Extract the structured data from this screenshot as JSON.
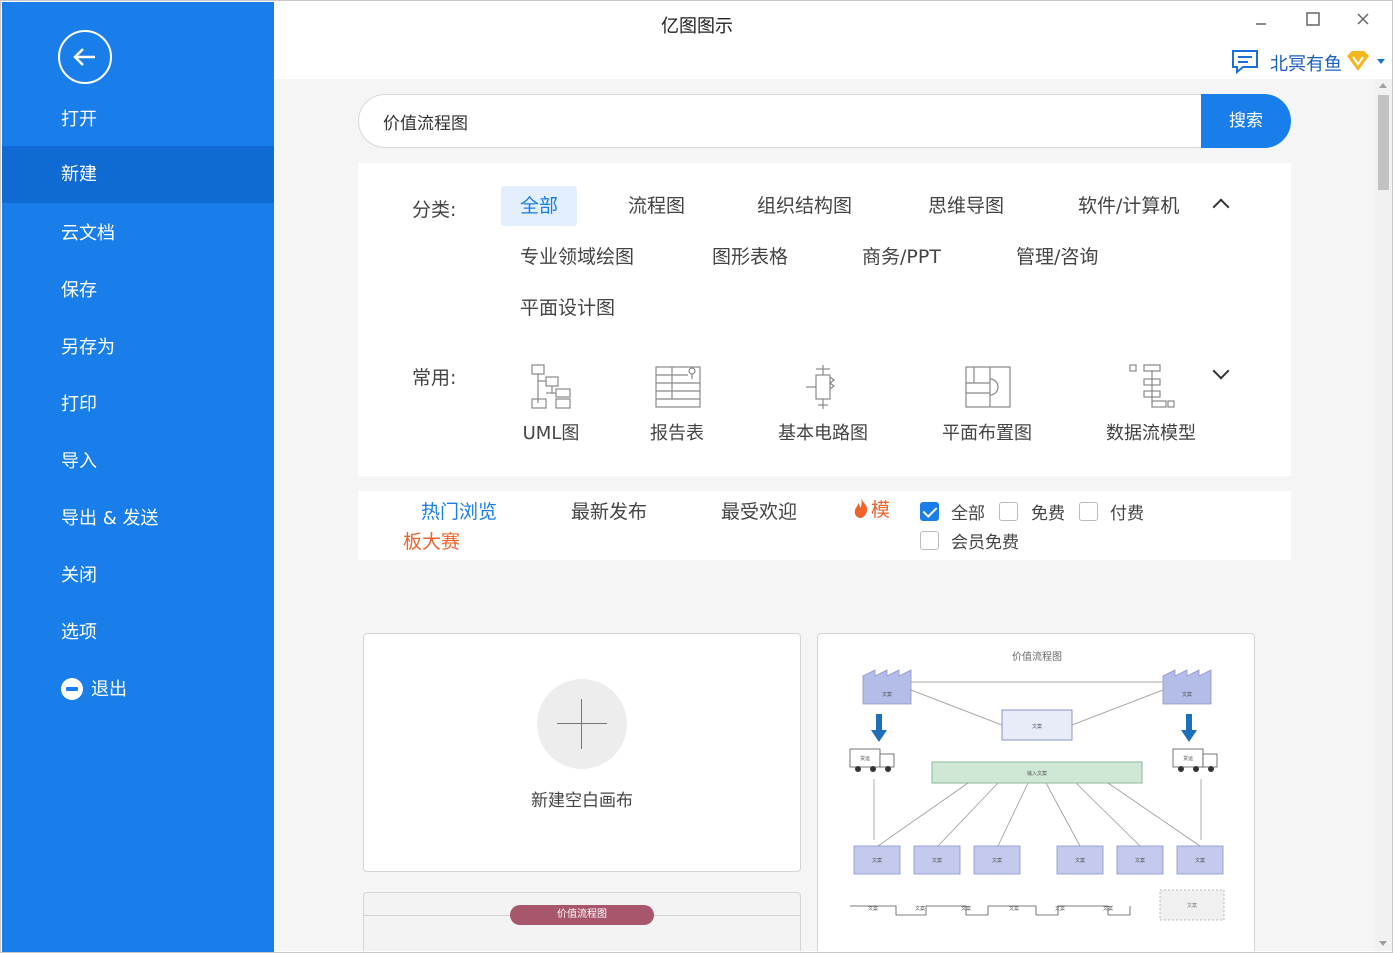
{
  "window": {
    "title": "亿图图示",
    "minimize_label": "–",
    "maximize_label": "□",
    "close_label": "✕"
  },
  "user": {
    "name": "北冥有鱼"
  },
  "sidebar": {
    "items": [
      {
        "label": "打开"
      },
      {
        "label": "新建"
      },
      {
        "label": "云文档"
      },
      {
        "label": "保存"
      },
      {
        "label": "另存为"
      },
      {
        "label": "打印"
      },
      {
        "label": "导入"
      },
      {
        "label": "导出 & 发送"
      },
      {
        "label": "关闭"
      },
      {
        "label": "选项"
      },
      {
        "label": "退出"
      }
    ],
    "active_index": 1
  },
  "search": {
    "value": "价值流程图",
    "button_label": "搜索"
  },
  "categories": {
    "label": "分类:",
    "items": [
      "全部",
      "流程图",
      "组织结构图",
      "思维导图",
      "软件/计算机",
      "专业领域绘图",
      "图形表格",
      "商务/PPT",
      "管理/咨询",
      "平面设计图"
    ],
    "active": "全部"
  },
  "common": {
    "label": "常用:",
    "items": [
      {
        "label": "UML图",
        "icon": "uml-icon"
      },
      {
        "label": "报告表",
        "icon": "report-table-icon"
      },
      {
        "label": "基本电路图",
        "icon": "circuit-icon"
      },
      {
        "label": "平面布置图",
        "icon": "floor-plan-icon"
      },
      {
        "label": "数据流模型",
        "icon": "data-flow-icon"
      }
    ]
  },
  "filters": {
    "tabs": [
      "热门浏览",
      "最新发布",
      "最受欢迎"
    ],
    "active_tab": "热门浏览",
    "contest_part1": "模",
    "contest_part2": "板大赛",
    "checkboxes": [
      {
        "label": "全部",
        "checked": true
      },
      {
        "label": "免费",
        "checked": false
      },
      {
        "label": "付费",
        "checked": false
      },
      {
        "label": "会员免费",
        "checked": false
      }
    ]
  },
  "cards": {
    "new_blank_label": "新建空白画布",
    "template_title": "价值流程图",
    "diagram": {
      "node": "文案",
      "center_bar": "输入文案",
      "truck": "货运"
    }
  },
  "colors": {
    "accent": "#1a7eea",
    "sidebar_active": "#0f6ad3",
    "contest": "#f0632d"
  }
}
